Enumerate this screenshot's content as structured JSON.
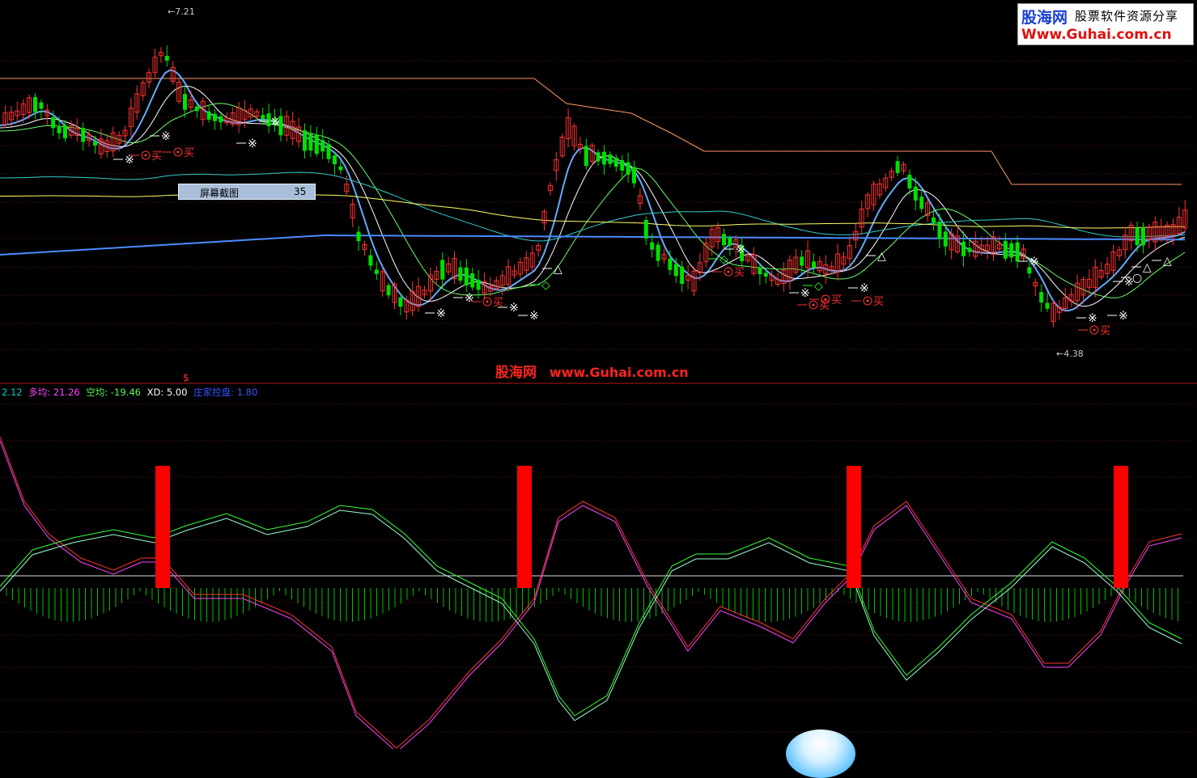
{
  "logo": {
    "name": "股海网",
    "slogan": "股票软件资源分享",
    "url": "Www.Guhai.com.cn"
  },
  "tooltip": {
    "label": "屏幕截图",
    "value": "35"
  },
  "watermark": {
    "name": "股海网",
    "url": "www.Guhai.com.cn"
  },
  "price_labels": {
    "high": "7.21",
    "low": "4.38"
  },
  "indicator_legend": [
    {
      "text": "2.12",
      "color": "#00cccc"
    },
    {
      "text": "多均: 21.26",
      "color": "#ff44ff"
    },
    {
      "text": "空均: -19.46",
      "color": "#55ff55"
    },
    {
      "text": "XD: 5.00",
      "color": "#ffffff"
    },
    {
      "text": "庄家控盘: 1.80",
      "color": "#3355ff"
    }
  ],
  "signal_labels": {
    "buy": "买",
    "mark_x": "※",
    "mark_d": "◇",
    "mark_t": "△",
    "mark_o": "○"
  },
  "colors": {
    "up": "#ff3232",
    "down": "#00e000",
    "grid": "#6a1010",
    "ma5": "#ffffff",
    "ma10": "#ffff66",
    "ma20": "#ff66ff",
    "ma60": "#66ff66",
    "trend_blue": "#66aaff",
    "cyan": "#33cccc",
    "orange": "#ff9966",
    "bar_signal": "#ff0000",
    "macd_bar": "#00c000"
  },
  "chart_data": {
    "type": "candlestick",
    "title": "",
    "y_range": [
      4.2,
      7.3
    ],
    "price_levels": {
      "max": 7.21,
      "min": 4.38
    },
    "indicator_series": [
      {
        "name": "多均",
        "value": 21.26
      },
      {
        "name": "空均",
        "value": -19.46
      },
      {
        "name": "XD",
        "value": 5.0
      },
      {
        "name": "庄家控盘",
        "value": 1.8
      }
    ],
    "signal_bars_count": 4
  }
}
